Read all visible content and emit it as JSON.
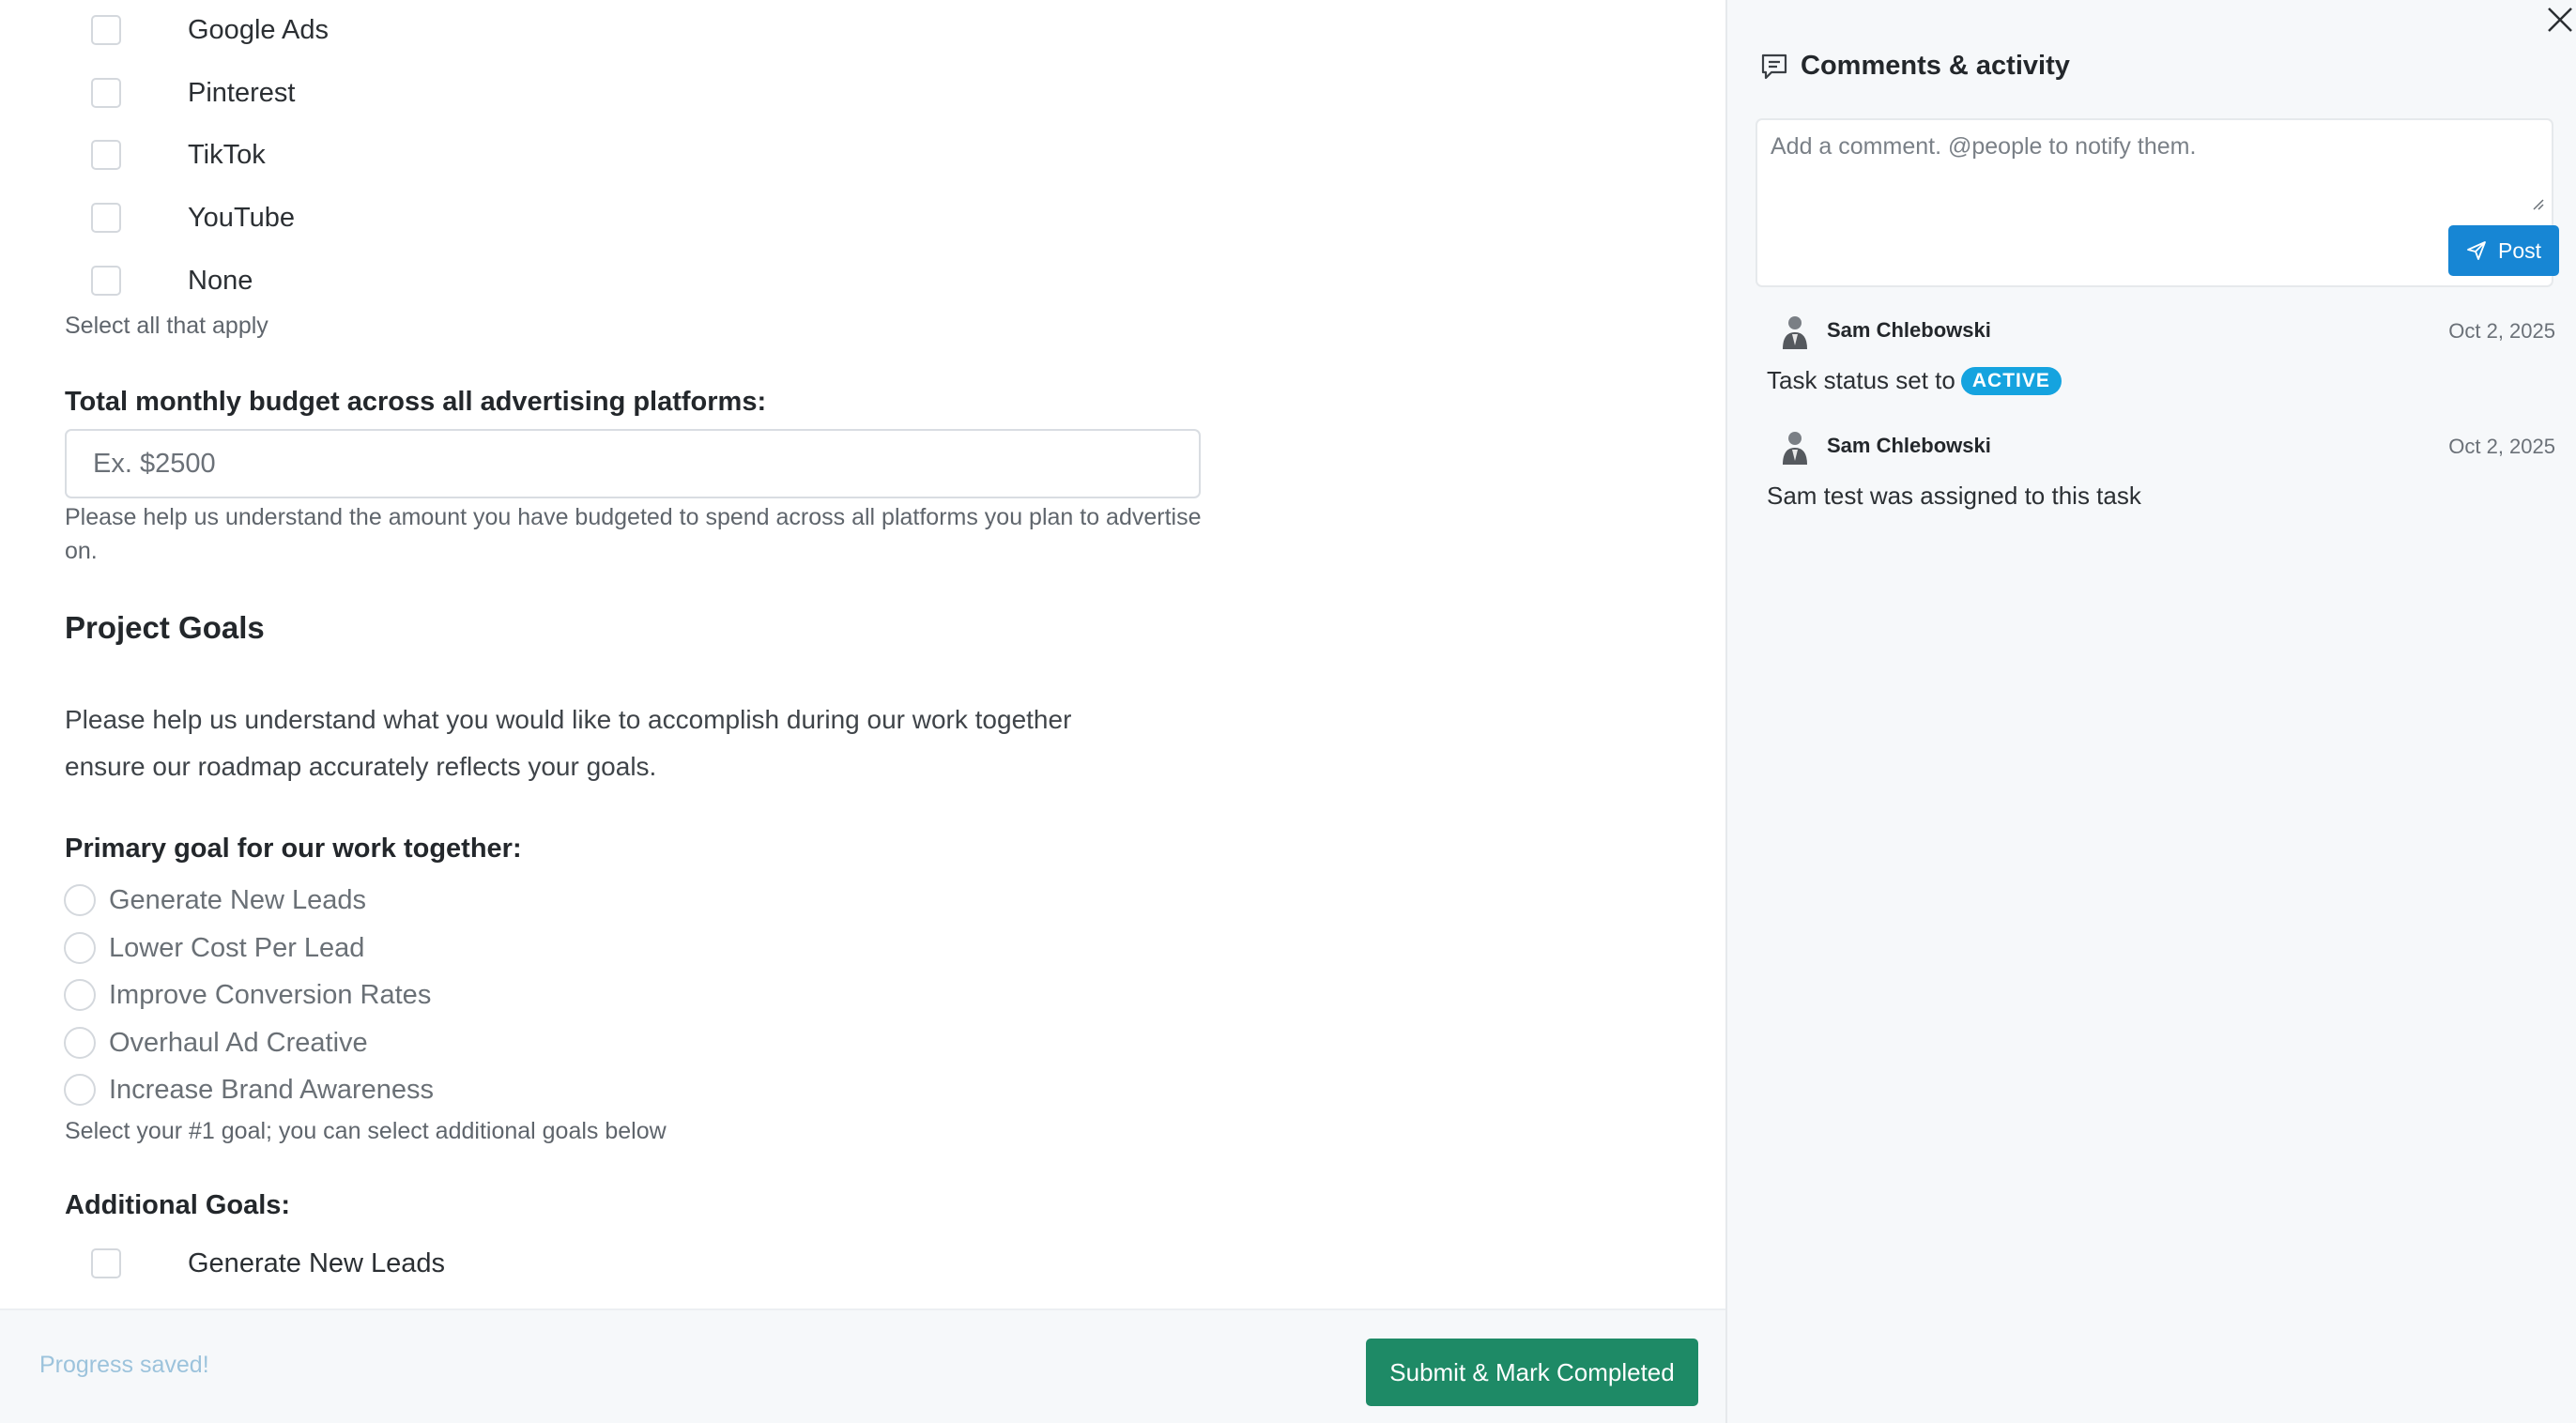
{
  "platforms": {
    "options": [
      "Google Ads",
      "Pinterest",
      "TikTok",
      "YouTube",
      "None"
    ],
    "help": "Select all that apply"
  },
  "budget": {
    "label": "Total monthly budget across all advertising platforms:",
    "placeholder": "Ex. $2500",
    "help": "Please help us understand the amount you have budgeted to spend across all platforms you plan to advertise on."
  },
  "project_goals": {
    "title": "Project Goals",
    "description": "Please help us understand what you would like to accomplish during our work together ensure our roadmap accurately reflects your goals."
  },
  "primary_goal": {
    "label": "Primary goal for our work together:",
    "options": [
      "Generate New Leads",
      "Lower Cost Per Lead",
      "Improve Conversion Rates",
      "Overhaul Ad Creative",
      "Increase Brand Awareness"
    ],
    "help": "Select your #1 goal; you can select additional goals below"
  },
  "additional_goals": {
    "label": "Additional Goals:",
    "options": [
      "Generate New Leads"
    ]
  },
  "footer": {
    "status": "Progress saved!",
    "submit_label": "Submit & Mark Completed"
  },
  "comments": {
    "title": "Comments & activity",
    "placeholder": "Add a comment. @people to notify them.",
    "post_label": "Post",
    "activity": [
      {
        "author": "Sam Chlebowski",
        "date": "Oct 2, 2025",
        "text": "Task status set to",
        "badge": "ACTIVE"
      },
      {
        "author": "Sam Chlebowski",
        "date": "Oct 2, 2025",
        "text": "Sam test was assigned to this task"
      }
    ]
  },
  "colors": {
    "submit": "#1e8a66",
    "post": "#1786d4",
    "badge": "#15a3df",
    "saved_text": "#9cc3dc"
  }
}
